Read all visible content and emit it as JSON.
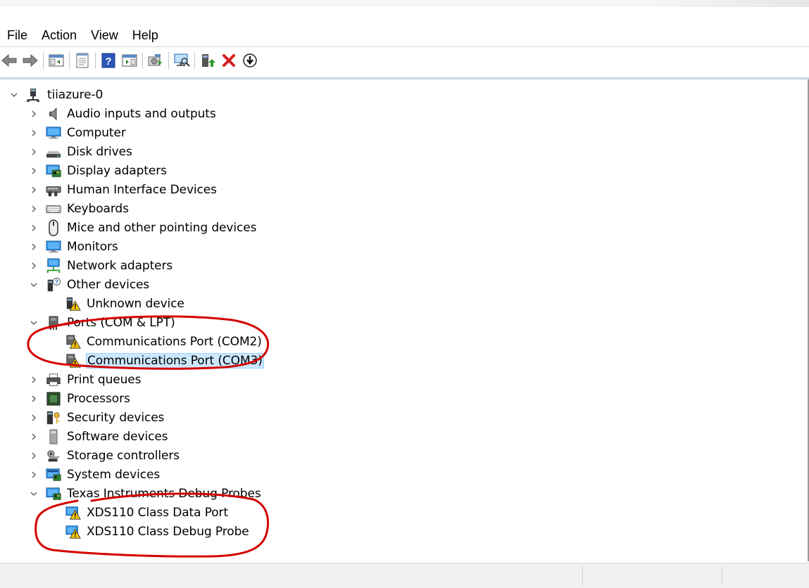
{
  "menu": {
    "file": "File",
    "action": "Action",
    "view": "View",
    "help": "Help"
  },
  "toolbar": {
    "buttons": [
      "back-icon",
      "forward-icon",
      "show-hide-console-tree-icon",
      "properties-icon",
      "help-icon",
      "action-pane-icon",
      "update-driver-icon",
      "scan-hardware-icon",
      "enable-device-icon",
      "uninstall-device-icon",
      "download-icon"
    ]
  },
  "tree": {
    "root": "tiiazure-0",
    "categories": {
      "audio": "Audio inputs and outputs",
      "computer": "Computer",
      "disk": "Disk drives",
      "display": "Display adapters",
      "hid": "Human Interface Devices",
      "keyboards": "Keyboards",
      "mice": "Mice and other pointing devices",
      "monitors": "Monitors",
      "network": "Network adapters",
      "other": "Other devices",
      "ports": "Ports (COM & LPT)",
      "print": "Print queues",
      "processors": "Processors",
      "security": "Security devices",
      "software": "Software devices",
      "storage": "Storage controllers",
      "system": "System devices",
      "ti": "Texas Instruments Debug Probes"
    },
    "devices": {
      "unknown": "Unknown device",
      "com2": "Communications Port (COM2)",
      "com3": "Communications Port (COM3)",
      "xds_data": "XDS110 Class Data Port",
      "xds_debug": "XDS110 Class Debug Probe"
    }
  },
  "colors": {
    "selection": "#cce8ff",
    "annotation": "#d40000",
    "warning": "#f5c400"
  }
}
